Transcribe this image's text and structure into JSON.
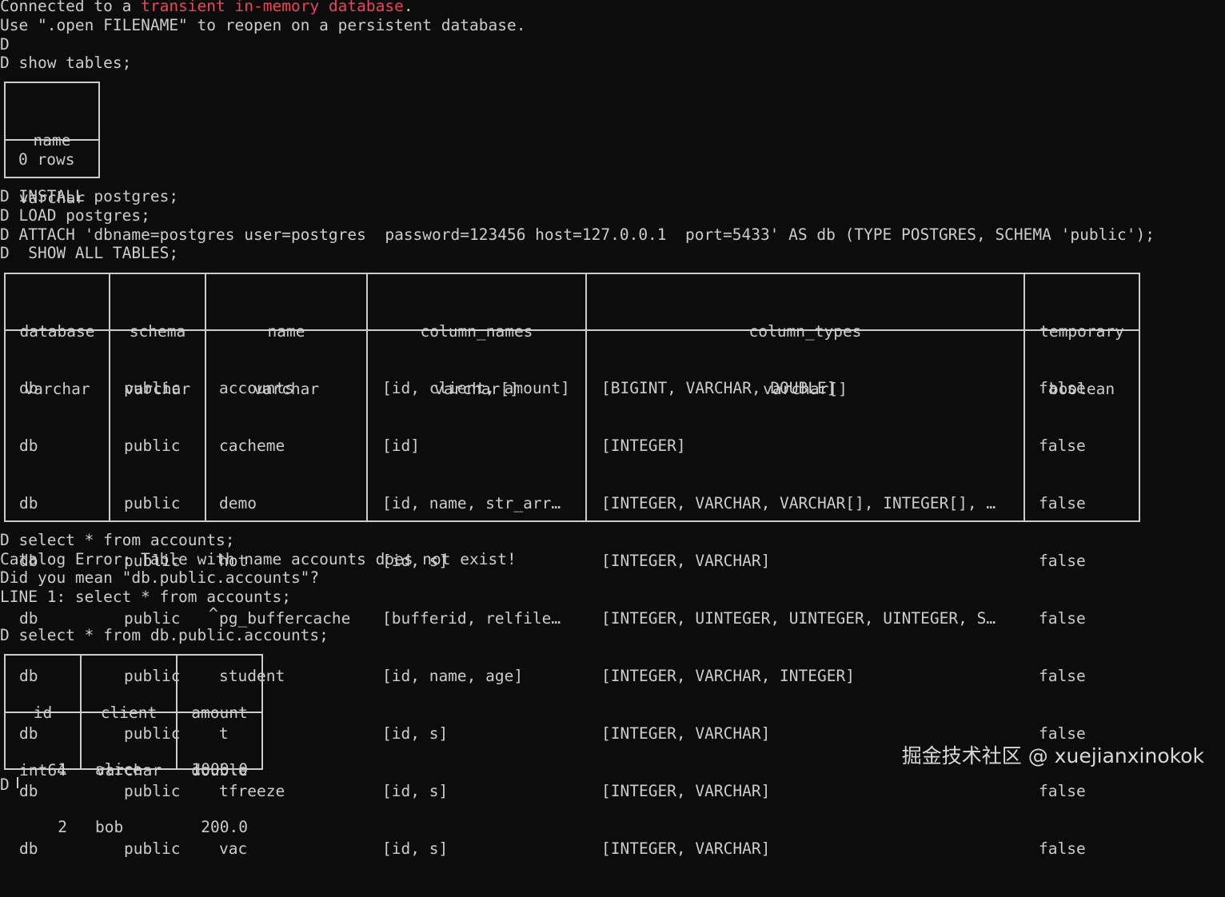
{
  "intro": {
    "connected_prefix": "Connected to a ",
    "connected_highlight": "transient in-memory database",
    "connected_suffix": ".",
    "reopen_hint": "Use \".open FILENAME\" to reopen on a persistent database."
  },
  "prompt_blank_1": "D",
  "cmd_show_tables": "D show tables;",
  "table1": {
    "col_name": "name",
    "col_type": "varchar",
    "rows_label": "0 rows"
  },
  "cmd_install": "D INSTALL postgres;",
  "cmd_load": "D LOAD postgres;",
  "cmd_attach": "D ATTACH 'dbname=postgres user=postgres  password=123456 host=127.0.0.1  port=5433' AS db (TYPE POSTGRES, SCHEMA 'public');",
  "cmd_show_all": "D  SHOW ALL TABLES;",
  "table2": {
    "headers": [
      {
        "name": "database",
        "type": "varchar"
      },
      {
        "name": "schema",
        "type": "varchar"
      },
      {
        "name": "name",
        "type": "varchar"
      },
      {
        "name": "column_names",
        "type": "varchar[]"
      },
      {
        "name": "column_types",
        "type": "varchar[]"
      },
      {
        "name": "temporary",
        "type": "boolean"
      }
    ],
    "rows": [
      [
        "db",
        "public",
        "accounts",
        "[id, client, amount]",
        "[BIGINT, VARCHAR, DOUBLE]",
        "false"
      ],
      [
        "db",
        "public",
        "cacheme",
        "[id]",
        "[INTEGER]",
        "false"
      ],
      [
        "db",
        "public",
        "demo",
        "[id, name, str_arr…",
        "[INTEGER, VARCHAR, VARCHAR[], INTEGER[], …",
        "false"
      ],
      [
        "db",
        "public",
        "hot",
        "[id, s]",
        "[INTEGER, VARCHAR]",
        "false"
      ],
      [
        "db",
        "public",
        "pg_buffercache",
        "[bufferid, relfile…",
        "[INTEGER, UINTEGER, UINTEGER, UINTEGER, S…",
        "false"
      ],
      [
        "db",
        "public",
        "student",
        "[id, name, age]",
        "[INTEGER, VARCHAR, INTEGER]",
        "false"
      ],
      [
        "db",
        "public",
        "t",
        "[id, s]",
        "[INTEGER, VARCHAR]",
        "false"
      ],
      [
        "db",
        "public",
        "tfreeze",
        "[id, s]",
        "[INTEGER, VARCHAR]",
        "false"
      ],
      [
        "db",
        "public",
        "vac",
        "[id, s]",
        "[INTEGER, VARCHAR]",
        "false"
      ]
    ]
  },
  "cmd_select_1": "D select * from accounts;",
  "error_line_1": "Catalog Error: Table with name accounts does not exist!",
  "error_line_2": "Did you mean \"db.public.accounts\"?",
  "error_line_3": "LINE 1: select * from accounts;",
  "error_caret": "^",
  "cmd_select_2": "D select * from db.public.accounts;",
  "table3": {
    "headers": [
      {
        "name": "id",
        "type": "int64"
      },
      {
        "name": "client",
        "type": "varchar"
      },
      {
        "name": "amount",
        "type": "double"
      }
    ],
    "rows": [
      [
        "1",
        "alice",
        "1000.0"
      ],
      [
        "2",
        "bob",
        "200.0"
      ]
    ]
  },
  "final_prompt": "D",
  "watermark": "掘金技术社区 @ xuejianxinokok"
}
